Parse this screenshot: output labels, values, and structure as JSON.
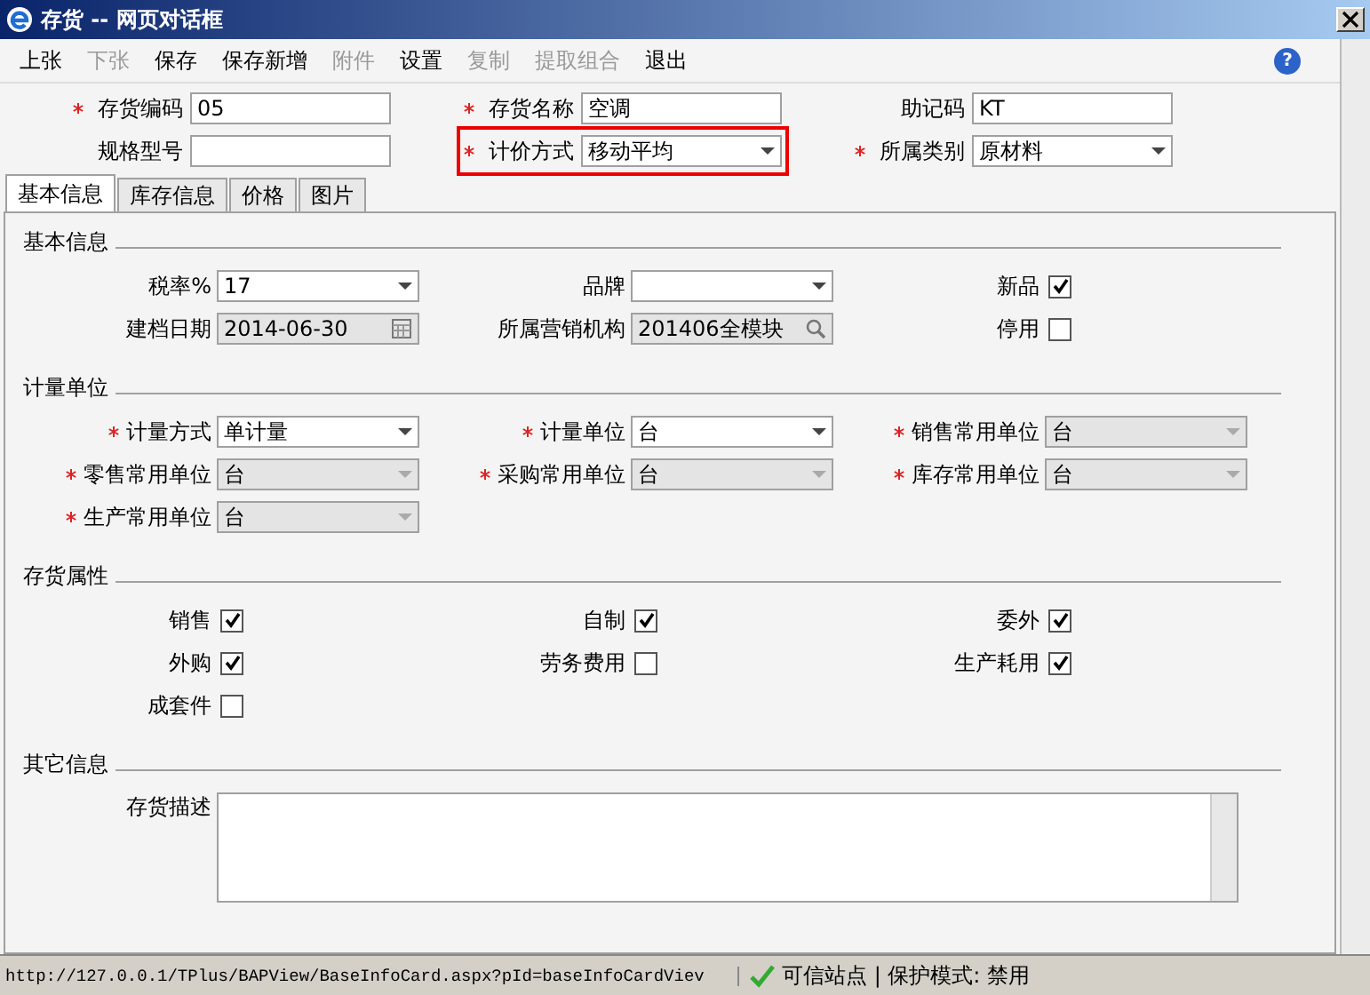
{
  "window": {
    "title": "存货 -- 网页对话框"
  },
  "toolbar": [
    {
      "label": "上张",
      "disabled": false
    },
    {
      "label": "下张",
      "disabled": true
    },
    {
      "label": "保存",
      "disabled": false
    },
    {
      "label": "保存新增",
      "disabled": false
    },
    {
      "label": "附件",
      "disabled": true
    },
    {
      "label": "设置",
      "disabled": false
    },
    {
      "label": "复制",
      "disabled": true
    },
    {
      "label": "提取组合",
      "disabled": true
    },
    {
      "label": "退出",
      "disabled": false
    }
  ],
  "header_fields": [
    {
      "label": "存货编码",
      "required": true,
      "kind": "text",
      "value": "05",
      "highlighted": false
    },
    {
      "label": "存货名称",
      "required": true,
      "kind": "text",
      "value": "空调",
      "highlighted": false
    },
    {
      "label": "助记码",
      "required": false,
      "kind": "text",
      "value": "KT",
      "highlighted": false
    },
    {
      "label": "规格型号",
      "required": false,
      "kind": "text",
      "highlighted": false
    },
    {
      "label": "计价方式",
      "required": true,
      "kind": "select",
      "value": "移动平均",
      "highlighted": true
    },
    {
      "label": "所属类别",
      "required": true,
      "kind": "select",
      "value": "原材料",
      "highlighted": false
    }
  ],
  "tabs": [
    {
      "label": "基本信息",
      "selected": true
    },
    {
      "label": "库存信息",
      "selected": false
    },
    {
      "label": "价格",
      "selected": false
    },
    {
      "label": "图片",
      "selected": false
    }
  ],
  "sections": [
    {
      "title": "基本信息",
      "fields": [
        {
          "label": "税率%",
          "required": false,
          "kind": "select",
          "value": "17",
          "disabled": false
        },
        {
          "label": "品牌",
          "required": false,
          "kind": "select",
          "disabled": false
        },
        {
          "label": "新品",
          "kind": "checkbox",
          "checked": true
        },
        {
          "label": "建档日期",
          "required": false,
          "kind": "date",
          "value": "2014-06-30",
          "disabled": true
        },
        {
          "label": "所属营销机构",
          "required": false,
          "kind": "lookup",
          "value": "201406全模块",
          "disabled": true
        },
        {
          "label": "停用",
          "kind": "checkbox",
          "checked": false
        }
      ]
    },
    {
      "title": "计量单位",
      "fields": [
        {
          "label": "计量方式",
          "required": true,
          "kind": "select",
          "value": "单计量",
          "disabled": false
        },
        {
          "label": "计量单位",
          "required": true,
          "kind": "select",
          "value": "台",
          "disabled": false
        },
        {
          "label": "销售常用单位",
          "required": true,
          "kind": "select",
          "value": "台",
          "disabled": true
        },
        {
          "label": "零售常用单位",
          "required": true,
          "kind": "select",
          "value": "台",
          "disabled": true
        },
        {
          "label": "采购常用单位",
          "required": true,
          "kind": "select",
          "value": "台",
          "disabled": true
        },
        {
          "label": "库存常用单位",
          "required": true,
          "kind": "select",
          "value": "台",
          "disabled": true
        },
        {
          "label": "生产常用单位",
          "required": true,
          "kind": "select",
          "value": "台",
          "disabled": true
        }
      ]
    },
    {
      "title": "存货属性",
      "fields": [
        {
          "label": "销售",
          "kind": "checkbox",
          "checked": true
        },
        {
          "label": "自制",
          "kind": "checkbox",
          "checked": true
        },
        {
          "label": "委外",
          "kind": "checkbox",
          "checked": true
        },
        {
          "label": "外购",
          "kind": "checkbox",
          "checked": true
        },
        {
          "label": "劳务费用",
          "kind": "checkbox",
          "checked": false
        },
        {
          "label": "生产耗用",
          "kind": "checkbox",
          "checked": true
        },
        {
          "label": "成套件",
          "kind": "checkbox",
          "checked": false
        }
      ]
    },
    {
      "title": "其它信息",
      "fields": [
        {
          "label": "存货描述",
          "required": false,
          "kind": "textarea",
          "disabled": false
        }
      ]
    }
  ],
  "help_button": "?",
  "status_bar": {
    "url": "http://127.0.0.1/TPlus/BAPView/BaseInfoCard.aspx?pId=baseInfoCardViev",
    "zone": "可信站点 | 保护模式: 禁用"
  }
}
